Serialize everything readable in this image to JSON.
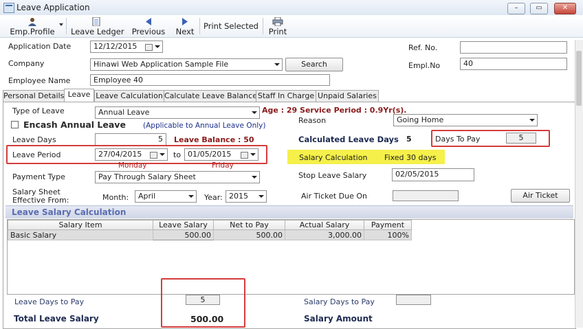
{
  "window": {
    "title": "Leave Application"
  },
  "toolbar": {
    "emp_profile": "Emp.Profile",
    "leave_ledger": "Leave Ledger",
    "previous": "Previous",
    "next": "Next",
    "print_selected": "Print Selected",
    "print": "Print"
  },
  "header": {
    "application_date_label": "Application Date",
    "application_date_value": "12/12/2015",
    "company_label": "Company",
    "company_value": "Hinawi Web Application Sample File",
    "search_button": "Search",
    "employee_name_label": "Employee Name",
    "employee_name_value": "Employee 40",
    "ref_no_label": "Ref. No.",
    "ref_no_value": "",
    "empl_no_label": "Empl.No",
    "empl_no_value": "40"
  },
  "tabs": [
    "Personal Details",
    "Leave",
    "Leave Calculation",
    "Calculate Leave Balance",
    "Staff In Charge",
    "Unpaid Salaries"
  ],
  "leave": {
    "type_label": "Type of Leave",
    "type_value": "Annual Leave",
    "age_service": "Age : 29 Service Period : 0.9Yr(s).",
    "encash_label": "Encash Annual Leave",
    "encash_note": "(Applicable to Annual Leave Only)",
    "reason_label": "Reason",
    "reason_value": "Going Home",
    "leave_days_label": "Leave Days",
    "leave_days_value": "5",
    "leave_balance": "Leave Balance : 50",
    "calc_days_label": "Calculated Leave Days",
    "calc_days_value": "5",
    "days_to_pay_label": "Days To Pay",
    "days_to_pay_value": "5",
    "leave_period_label": "Leave Period",
    "period_from": "27/04/2015",
    "period_to_label": "to",
    "period_to": "01/05/2015",
    "from_day": "Monday",
    "to_day": "Friday",
    "salary_calc_label": "Salary Calculation",
    "salary_calc_value": "Fixed 30 days",
    "payment_type_label": "Payment Type",
    "payment_type_value": "Pay Through Salary Sheet",
    "stop_salary_label": "Stop Leave Salary",
    "stop_salary_value": "02/05/2015",
    "sheet_label_1": "Salary Sheet",
    "sheet_label_2": "Effective From:",
    "month_label": "Month:",
    "month_value": "April",
    "year_label": "Year:",
    "year_value": "2015",
    "air_due_label": "Air Ticket Due On",
    "air_due_value": "",
    "air_ticket_button": "Air Ticket"
  },
  "salary_section": {
    "title": "Leave Salary Calculation",
    "columns": [
      "Salary Item",
      "Leave Salary",
      "Net to Pay",
      "Actual Salary",
      "Payment"
    ],
    "rows": [
      [
        "Basic Salary",
        "500.00",
        "500.00",
        "3,000.00",
        "100%"
      ]
    ]
  },
  "footer": {
    "leave_days_to_pay_label": "Leave Days to Pay",
    "leave_days_to_pay_value": "5",
    "salary_days_to_pay_label": "Salary Days to Pay",
    "salary_days_to_pay_value": "",
    "total_leave_salary_label": "Total Leave Salary",
    "total_leave_salary_value": "500.00",
    "salary_amount_label": "Salary Amount"
  },
  "colors": {
    "highlight": "#f5f04a",
    "annotation_red": "#d43c3c",
    "section_blue": "#5a6db0"
  }
}
